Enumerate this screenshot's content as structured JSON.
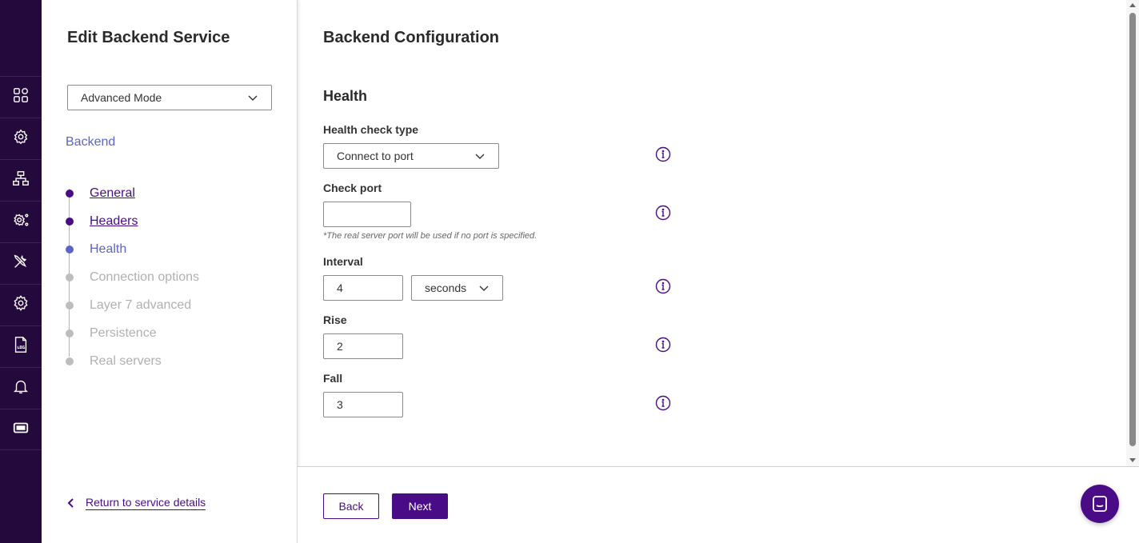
{
  "colors": {
    "brand": "#4a0b87",
    "rail_bg": "#240a3c",
    "active_step": "#5b64c8",
    "pending_step": "#b0b0b0"
  },
  "rail": {
    "items": [
      {
        "icon": "dashboard-icon"
      },
      {
        "icon": "services-icon"
      },
      {
        "icon": "network-icon"
      },
      {
        "icon": "cluster-settings-icon"
      },
      {
        "icon": "tools-icon"
      },
      {
        "icon": "settings-icon"
      },
      {
        "icon": "log-file-icon"
      },
      {
        "icon": "bell-icon"
      },
      {
        "icon": "ticket-icon"
      }
    ]
  },
  "sidebar": {
    "title": "Edit Backend Service",
    "mode_select": {
      "value": "Advanced Mode"
    },
    "section_label": "Backend",
    "steps": [
      {
        "label": "General",
        "state": "done"
      },
      {
        "label": "Headers",
        "state": "done"
      },
      {
        "label": "Health",
        "state": "active"
      },
      {
        "label": "Connection options",
        "state": "pending"
      },
      {
        "label": "Layer 7 advanced",
        "state": "pending"
      },
      {
        "label": "Persistence",
        "state": "pending"
      },
      {
        "label": "Real servers",
        "state": "pending"
      }
    ],
    "return_link": "Return to service details"
  },
  "main": {
    "title": "Backend Configuration",
    "section": "Health",
    "fields": {
      "health_check_type": {
        "label": "Health check type",
        "value": "Connect to port"
      },
      "check_port": {
        "label": "Check port",
        "value": "",
        "hint": "*The real server port will be used if no port is specified."
      },
      "interval": {
        "label": "Interval",
        "value": "4",
        "unit": "seconds"
      },
      "rise": {
        "label": "Rise",
        "value": "2"
      },
      "fall": {
        "label": "Fall",
        "value": "3"
      }
    }
  },
  "footer": {
    "back_label": "Back",
    "next_label": "Next"
  }
}
